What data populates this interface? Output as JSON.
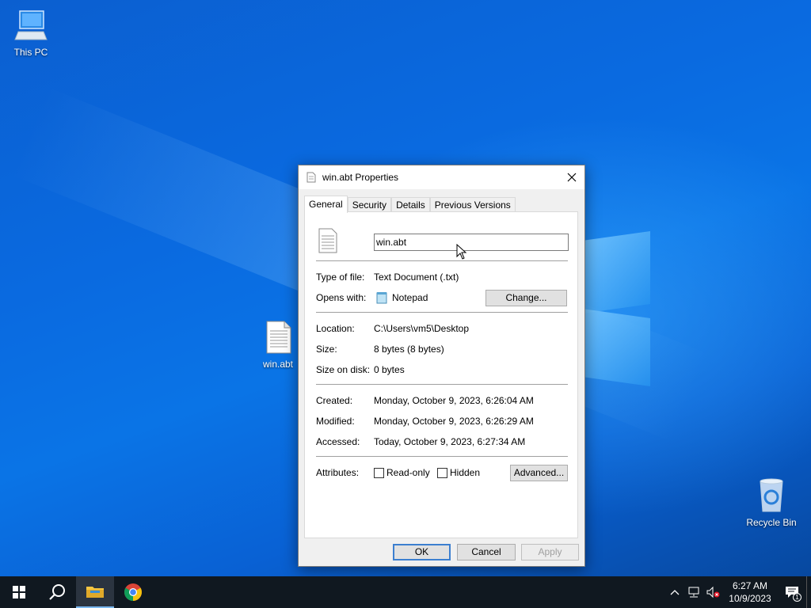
{
  "desktop": {
    "icons": [
      {
        "label": "This PC"
      },
      {
        "label": "win.abt"
      },
      {
        "label": "Recycle Bin"
      }
    ]
  },
  "dialog": {
    "title": "win.abt Properties",
    "tabs": [
      "General",
      "Security",
      "Details",
      "Previous Versions"
    ],
    "file_name": "win.abt",
    "type_label": "Type of file:",
    "type_value": "Text Document (.txt)",
    "opens_label": "Opens with:",
    "opens_value": "Notepad",
    "change_label": "Change...",
    "location_label": "Location:",
    "location_value": "C:\\Users\\vm5\\Desktop",
    "size_label": "Size:",
    "size_value": "8 bytes (8 bytes)",
    "size_disk_label": "Size on disk:",
    "size_disk_value": "0 bytes",
    "created_label": "Created:",
    "created_value": "Monday, October 9, 2023, 6:26:04 AM",
    "modified_label": "Modified:",
    "modified_value": "Monday, October 9, 2023, 6:26:29 AM",
    "accessed_label": "Accessed:",
    "accessed_value": "Today, October 9, 2023, 6:27:34 AM",
    "attributes_label": "Attributes:",
    "readonly_label": "Read-only",
    "hidden_label": "Hidden",
    "advanced_label": "Advanced...",
    "ok_label": "OK",
    "cancel_label": "Cancel",
    "apply_label": "Apply"
  },
  "taskbar": {
    "time": "6:27 AM",
    "date": "10/9/2023",
    "notification_count": "1"
  }
}
